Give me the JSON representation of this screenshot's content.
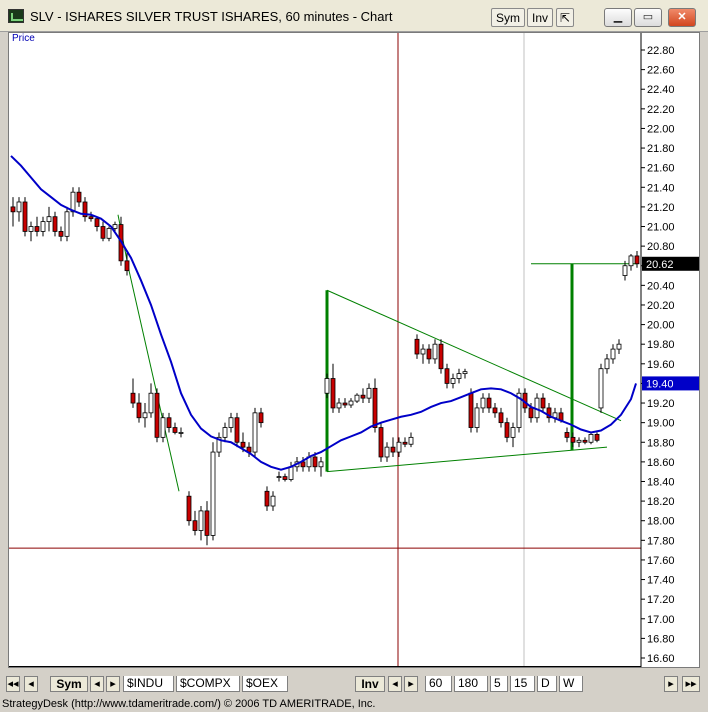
{
  "window": {
    "title": "SLV - ISHARES SILVER TRUST ISHARES, 60 minutes - Chart",
    "sym_button": "Sym",
    "inv_button": "Inv",
    "minimize_icon": "minimize-icon",
    "maximize_icon": "maximize-icon",
    "close_icon": "close-icon"
  },
  "chart": {
    "price_label": "Price",
    "last_price_badge": "20.62",
    "ma_price_badge": "19.40",
    "colors": {
      "ma_line": "#0000c8",
      "up_candle": "#ffffff",
      "down_candle": "#c80000",
      "trendline": "#008000",
      "crosshair": "#8b0000",
      "badge_black": "#000000",
      "badge_blue": "#0000c8"
    }
  },
  "chart_data": {
    "type": "candlestick",
    "symbol": "SLV",
    "interval": "60 minutes",
    "y_ticks": [
      "22.80",
      "22.60",
      "22.40",
      "22.20",
      "22.00",
      "21.80",
      "21.60",
      "21.40",
      "21.20",
      "21.00",
      "20.80",
      "20.60",
      "20.40",
      "20.20",
      "20.00",
      "19.80",
      "19.60",
      "19.40",
      "19.20",
      "19.00",
      "18.80",
      "18.60",
      "18.40",
      "18.20",
      "18.00",
      "17.80",
      "17.60",
      "17.40",
      "17.20",
      "17.00",
      "16.80",
      "16.60"
    ],
    "ylim": [
      16.5,
      22.95
    ],
    "last_price": 20.62,
    "moving_average_last": 19.4,
    "horizontal_crosshair": 17.72,
    "moving_average": [
      [
        0,
        21.72
      ],
      [
        10,
        21.62
      ],
      [
        20,
        21.5
      ],
      [
        30,
        21.38
      ],
      [
        40,
        21.3
      ],
      [
        50,
        21.22
      ],
      [
        60,
        21.17
      ],
      [
        70,
        21.13
      ],
      [
        80,
        21.12
      ],
      [
        90,
        21.08
      ],
      [
        100,
        21.0
      ],
      [
        110,
        20.85
      ],
      [
        120,
        20.68
      ],
      [
        130,
        20.45
      ],
      [
        140,
        20.2
      ],
      [
        150,
        19.9
      ],
      [
        160,
        19.62
      ],
      [
        170,
        19.3
      ],
      [
        180,
        19.08
      ],
      [
        190,
        18.94
      ],
      [
        200,
        18.86
      ],
      [
        210,
        18.82
      ],
      [
        220,
        18.8
      ],
      [
        230,
        18.74
      ],
      [
        240,
        18.68
      ],
      [
        250,
        18.6
      ],
      [
        260,
        18.55
      ],
      [
        270,
        18.52
      ],
      [
        280,
        18.55
      ],
      [
        290,
        18.6
      ],
      [
        300,
        18.66
      ],
      [
        310,
        18.7
      ],
      [
        320,
        18.76
      ],
      [
        330,
        18.82
      ],
      [
        340,
        18.86
      ],
      [
        350,
        18.9
      ],
      [
        360,
        18.96
      ],
      [
        370,
        19.0
      ],
      [
        380,
        19.03
      ],
      [
        390,
        19.06
      ],
      [
        400,
        19.08
      ],
      [
        410,
        19.11
      ],
      [
        420,
        19.16
      ],
      [
        430,
        19.2
      ],
      [
        440,
        19.22
      ],
      [
        450,
        19.26
      ],
      [
        460,
        19.3
      ],
      [
        470,
        19.34
      ],
      [
        480,
        19.35
      ],
      [
        490,
        19.34
      ],
      [
        500,
        19.3
      ],
      [
        510,
        19.24
      ],
      [
        520,
        19.16
      ],
      [
        530,
        19.12
      ],
      [
        540,
        19.06
      ],
      [
        550,
        19.02
      ],
      [
        560,
        18.98
      ],
      [
        570,
        18.93
      ],
      [
        580,
        18.9
      ],
      [
        590,
        18.92
      ],
      [
        600,
        18.98
      ],
      [
        610,
        19.08
      ],
      [
        620,
        19.24
      ],
      [
        625,
        19.4
      ]
    ],
    "candles": [
      [
        2,
        21.2,
        21.3,
        21.0,
        21.15
      ],
      [
        8,
        21.15,
        21.3,
        21.05,
        21.25
      ],
      [
        14,
        21.25,
        21.3,
        20.9,
        20.95
      ],
      [
        20,
        20.95,
        21.05,
        20.85,
        21.0
      ],
      [
        26,
        21.0,
        21.1,
        20.9,
        20.95
      ],
      [
        32,
        20.95,
        21.1,
        20.9,
        21.05
      ],
      [
        38,
        21.05,
        21.2,
        20.95,
        21.1
      ],
      [
        44,
        21.1,
        21.15,
        20.9,
        20.95
      ],
      [
        50,
        20.95,
        21.0,
        20.85,
        20.9
      ],
      [
        56,
        20.9,
        21.2,
        20.85,
        21.15
      ],
      [
        62,
        21.15,
        21.4,
        21.1,
        21.35
      ],
      [
        68,
        21.35,
        21.4,
        21.2,
        21.25
      ],
      [
        74,
        21.25,
        21.3,
        21.05,
        21.1
      ],
      [
        80,
        21.1,
        21.15,
        21.05,
        21.08
      ],
      [
        86,
        21.08,
        21.1,
        20.95,
        21.0
      ],
      [
        92,
        21.0,
        21.05,
        20.85,
        20.88
      ],
      [
        98,
        20.88,
        21.0,
        20.85,
        20.98
      ],
      [
        104,
        20.98,
        21.05,
        20.95,
        21.02
      ],
      [
        110,
        21.02,
        21.1,
        20.6,
        20.65
      ],
      [
        116,
        20.65,
        20.75,
        20.5,
        20.55
      ],
      [
        122,
        19.3,
        19.45,
        19.15,
        19.2
      ],
      [
        128,
        19.2,
        19.3,
        19.0,
        19.05
      ],
      [
        134,
        19.05,
        19.2,
        18.95,
        19.1
      ],
      [
        140,
        19.1,
        19.4,
        19.05,
        19.3
      ],
      [
        146,
        19.3,
        19.35,
        18.8,
        18.85
      ],
      [
        152,
        18.85,
        19.1,
        18.8,
        19.05
      ],
      [
        158,
        19.05,
        19.1,
        18.9,
        18.95
      ],
      [
        164,
        18.95,
        19.0,
        18.88,
        18.9
      ],
      [
        170,
        18.9,
        18.95,
        18.85,
        18.9
      ],
      [
        178,
        18.25,
        18.3,
        17.95,
        18.0
      ],
      [
        184,
        18.0,
        18.1,
        17.85,
        17.9
      ],
      [
        190,
        17.9,
        18.15,
        17.8,
        18.1
      ],
      [
        196,
        18.1,
        18.2,
        17.75,
        17.85
      ],
      [
        202,
        17.85,
        18.8,
        17.8,
        18.7
      ],
      [
        208,
        18.7,
        18.9,
        18.65,
        18.85
      ],
      [
        214,
        18.85,
        19.0,
        18.8,
        18.95
      ],
      [
        220,
        18.95,
        19.1,
        18.9,
        19.05
      ],
      [
        226,
        19.05,
        19.1,
        18.75,
        18.8
      ],
      [
        232,
        18.8,
        18.9,
        18.7,
        18.75
      ],
      [
        238,
        18.75,
        18.8,
        18.65,
        18.7
      ],
      [
        244,
        18.7,
        19.15,
        18.65,
        19.1
      ],
      [
        250,
        19.1,
        19.15,
        18.95,
        19.0
      ],
      [
        256,
        18.3,
        18.35,
        18.1,
        18.15
      ],
      [
        262,
        18.15,
        18.3,
        18.1,
        18.25
      ],
      [
        268,
        18.45,
        18.5,
        18.4,
        18.45
      ],
      [
        274,
        18.45,
        18.48,
        18.4,
        18.42
      ],
      [
        280,
        18.42,
        18.6,
        18.4,
        18.55
      ],
      [
        286,
        18.55,
        18.65,
        18.5,
        18.6
      ],
      [
        292,
        18.6,
        18.65,
        18.5,
        18.55
      ],
      [
        298,
        18.55,
        18.7,
        18.5,
        18.65
      ],
      [
        304,
        18.65,
        18.7,
        18.5,
        18.55
      ],
      [
        310,
        18.55,
        18.65,
        18.45,
        18.6
      ],
      [
        316,
        19.3,
        19.5,
        19.25,
        19.45
      ],
      [
        322,
        19.45,
        19.6,
        19.1,
        19.15
      ],
      [
        328,
        19.15,
        19.25,
        19.1,
        19.2
      ],
      [
        334,
        19.2,
        19.25,
        19.15,
        19.18
      ],
      [
        340,
        19.18,
        19.25,
        19.15,
        19.22
      ],
      [
        346,
        19.22,
        19.3,
        19.2,
        19.28
      ],
      [
        352,
        19.28,
        19.35,
        19.2,
        19.25
      ],
      [
        358,
        19.25,
        19.4,
        19.2,
        19.35
      ],
      [
        364,
        19.35,
        19.45,
        18.9,
        18.95
      ],
      [
        370,
        18.95,
        19.0,
        18.6,
        18.65
      ],
      [
        376,
        18.65,
        18.8,
        18.6,
        18.75
      ],
      [
        382,
        18.75,
        18.85,
        18.65,
        18.7
      ],
      [
        388,
        18.7,
        18.85,
        18.65,
        18.8
      ],
      [
        394,
        18.8,
        18.85,
        18.75,
        18.78
      ],
      [
        400,
        18.78,
        18.9,
        18.75,
        18.85
      ],
      [
        406,
        19.85,
        19.9,
        19.65,
        19.7
      ],
      [
        412,
        19.7,
        19.8,
        19.6,
        19.75
      ],
      [
        418,
        19.75,
        19.8,
        19.6,
        19.65
      ],
      [
        424,
        19.65,
        19.85,
        19.6,
        19.8
      ],
      [
        430,
        19.8,
        19.85,
        19.5,
        19.55
      ],
      [
        436,
        19.55,
        19.6,
        19.35,
        19.4
      ],
      [
        442,
        19.4,
        19.5,
        19.35,
        19.45
      ],
      [
        448,
        19.45,
        19.55,
        19.4,
        19.5
      ],
      [
        454,
        19.5,
        19.55,
        19.45,
        19.52
      ],
      [
        460,
        19.3,
        19.35,
        18.9,
        18.95
      ],
      [
        466,
        18.95,
        19.2,
        18.9,
        19.15
      ],
      [
        472,
        19.15,
        19.3,
        19.1,
        19.25
      ],
      [
        478,
        19.25,
        19.3,
        19.1,
        19.15
      ],
      [
        484,
        19.15,
        19.2,
        19.05,
        19.1
      ],
      [
        490,
        19.1,
        19.15,
        18.95,
        19.0
      ],
      [
        496,
        19.0,
        19.05,
        18.8,
        18.85
      ],
      [
        502,
        18.85,
        19.0,
        18.75,
        18.95
      ],
      [
        508,
        18.95,
        19.35,
        18.9,
        19.3
      ],
      [
        514,
        19.3,
        19.35,
        19.1,
        19.15
      ],
      [
        520,
        19.15,
        19.2,
        19.0,
        19.05
      ],
      [
        526,
        19.05,
        19.3,
        19.0,
        19.25
      ],
      [
        532,
        19.25,
        19.3,
        19.1,
        19.15
      ],
      [
        538,
        19.15,
        19.2,
        19.0,
        19.05
      ],
      [
        544,
        19.05,
        19.15,
        19.0,
        19.1
      ],
      [
        550,
        19.1,
        19.15,
        19.0,
        19.02
      ],
      [
        556,
        18.9,
        18.95,
        18.8,
        18.85
      ],
      [
        562,
        18.85,
        18.9,
        18.75,
        18.8
      ],
      [
        568,
        18.8,
        18.85,
        18.75,
        18.82
      ],
      [
        574,
        18.82,
        18.85,
        18.78,
        18.8
      ],
      [
        580,
        18.8,
        18.9,
        18.78,
        18.88
      ],
      [
        586,
        18.88,
        18.9,
        18.8,
        18.82
      ],
      [
        590,
        19.15,
        19.6,
        19.1,
        19.55
      ],
      [
        596,
        19.55,
        19.7,
        19.5,
        19.65
      ],
      [
        602,
        19.65,
        19.8,
        19.6,
        19.75
      ],
      [
        608,
        19.75,
        19.85,
        19.7,
        19.8
      ],
      [
        614,
        20.5,
        20.65,
        20.45,
        20.6
      ],
      [
        620,
        20.6,
        20.72,
        20.55,
        20.7
      ],
      [
        626,
        20.7,
        20.75,
        20.58,
        20.62
      ]
    ]
  },
  "tabs": {
    "sym": "Sym",
    "symbols": [
      "$INDU",
      "$COMPX",
      "$OEX"
    ],
    "inv": "Inv",
    "intervals": [
      "60",
      "180",
      "5",
      "15",
      "D",
      "W"
    ]
  },
  "status": {
    "text": "StrategyDesk (http://www.tdameritrade.com/) © 2006 TD AMERITRADE, Inc."
  }
}
